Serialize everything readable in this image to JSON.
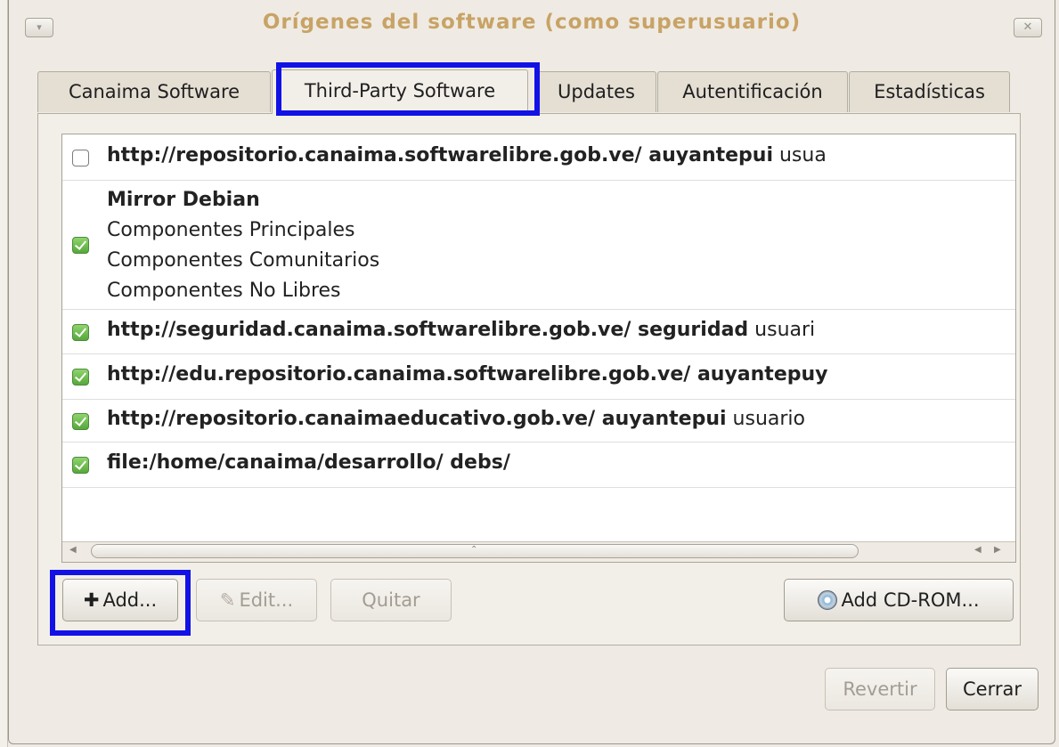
{
  "window": {
    "title": "Orígenes del software (como superusuario)",
    "menu_icon": "chevron-down-icon",
    "close_icon": "close-icon"
  },
  "tabs": [
    {
      "label": "Canaima Software",
      "active": false
    },
    {
      "label": "Third-Party Software",
      "active": true
    },
    {
      "label": "Updates",
      "active": false
    },
    {
      "label": "Autentificación",
      "active": false
    },
    {
      "label": "Estadísticas",
      "active": false
    }
  ],
  "sources": [
    {
      "checked": false,
      "bold": "http://repositorio.canaima.softwarelibre.gob.ve/ auyantepui",
      "normal": " usua"
    },
    {
      "checked": true,
      "bold": "Mirror Debian",
      "components": [
        "Componentes Principales",
        "Componentes Comunitarios",
        "Componentes No Libres"
      ]
    },
    {
      "checked": true,
      "bold": "http://seguridad.canaima.softwarelibre.gob.ve/ seguridad",
      "normal": " usuari"
    },
    {
      "checked": true,
      "bold": "http://edu.repositorio.canaima.softwarelibre.gob.ve/ auyantepuy",
      "normal": ""
    },
    {
      "checked": true,
      "bold": "http://repositorio.canaimaeducativo.gob.ve/ auyantepui",
      "normal": " usuario"
    },
    {
      "checked": true,
      "bold": "file:/home/canaima/desarrollo/ debs/",
      "normal": ""
    }
  ],
  "buttons": {
    "add": {
      "label": "Add...",
      "icon": "plus-icon"
    },
    "edit": {
      "label": "Edit...",
      "icon": "pencil-icon",
      "disabled": true
    },
    "remove": {
      "label": "Quitar",
      "disabled": true
    },
    "add_cdrom": {
      "label": "Add CD-ROM...",
      "icon": "cdrom-icon"
    },
    "revert": {
      "label": "Revertir",
      "disabled": true
    },
    "close": {
      "label": "Cerrar"
    }
  },
  "colors": {
    "highlight": "#1212e6",
    "title": "#c8a366",
    "checked": "#6cbb4a"
  }
}
